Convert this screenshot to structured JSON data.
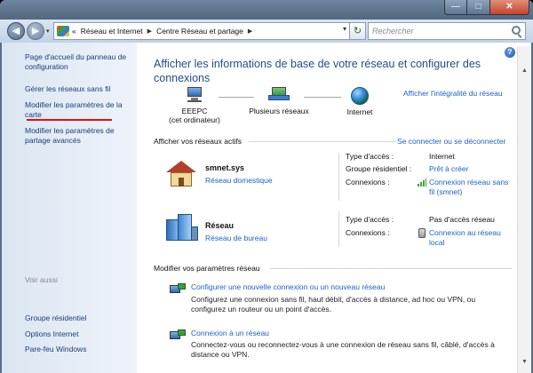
{
  "window": {
    "minimize_glyph": "—",
    "maximize_glyph": "□",
    "close_glyph": "✕"
  },
  "navbar": {
    "back_glyph": "◀",
    "forward_glyph": "▶",
    "history_glyph": "▾",
    "address": {
      "overflow": "«",
      "crumbs": [
        "Réseau et Internet",
        "Centre Réseau et partage"
      ],
      "separator": "▶",
      "dropdown_glyph": "▾"
    },
    "refresh_glyph": "↻",
    "search": {
      "placeholder": "Rechercher",
      "value": ""
    }
  },
  "sidebar": {
    "items": [
      {
        "label": "Page d'accueil du panneau de configuration"
      },
      {
        "label": "Gérer les réseaux sans fil"
      },
      {
        "label": "Modifier les paramètres de la carte"
      },
      {
        "label": "Modifier les paramètres de partage avancés"
      }
    ],
    "see_also": {
      "heading": "Voir aussi",
      "items": [
        {
          "label": "Groupe résidentiel"
        },
        {
          "label": "Options Internet"
        },
        {
          "label": "Pare-feu Windows"
        }
      ]
    },
    "highlight_color": "#e01010"
  },
  "main": {
    "help_glyph": "?",
    "scroll_up_glyph": "▲",
    "scroll_down_glyph": "▼",
    "title": "Afficher les informations de base de votre réseau et configurer des connexions",
    "full_map_link": "Afficher l'intégralité du réseau",
    "network_map": {
      "nodes": [
        {
          "label": "EEEPC",
          "sublabel": "(cet ordinateur)",
          "icon": "computer-icon"
        },
        {
          "label": "Plusieurs réseaux",
          "icon": "multiple-networks-icon"
        },
        {
          "label": "Internet",
          "icon": "globe-icon"
        }
      ]
    },
    "active_networks": {
      "heading": "Afficher vos réseaux actifs",
      "connect_link": "Se connecter ou se déconnecter",
      "networks": [
        {
          "name": "smnet.sys",
          "type": "Réseau domestique",
          "icon": "house-icon",
          "props": [
            {
              "label": "Type d'accès :",
              "value": "Internet"
            },
            {
              "label": "Groupe résidentiel :",
              "value": "Prêt à créer",
              "is_link": true
            },
            {
              "label": "Connexions :",
              "value": "Connexion réseau sans fil (smnet)",
              "is_link": true,
              "icon": "wifi-signal-icon"
            }
          ]
        },
        {
          "name": "Réseau",
          "type": "Réseau de bureau",
          "icon": "office-building-icon",
          "props": [
            {
              "label": "Type d'accès :",
              "value": "Pas d'accès réseau"
            },
            {
              "label": "Connexions :",
              "value": "Connexion au réseau local",
              "is_link": true,
              "icon": "ethernet-plug-icon"
            }
          ]
        }
      ]
    },
    "settings": {
      "heading": "Modifier vos paramètres réseau",
      "tasks": [
        {
          "link": "Configurer une nouvelle connexion ou un nouveau réseau",
          "description": "Configurez une connexion sans fil, haut débit, d'accès à distance, ad hoc ou VPN, ou configurez un routeur ou un point d'accès."
        },
        {
          "link": "Connexion à un réseau",
          "description": "Connectez-vous ou reconnectez-vous à une connexion de réseau sans fil, câblé, d'accès à distance ou VPN."
        }
      ]
    },
    "link_color": "#1b62c8",
    "title_color": "#1e4e8c"
  }
}
